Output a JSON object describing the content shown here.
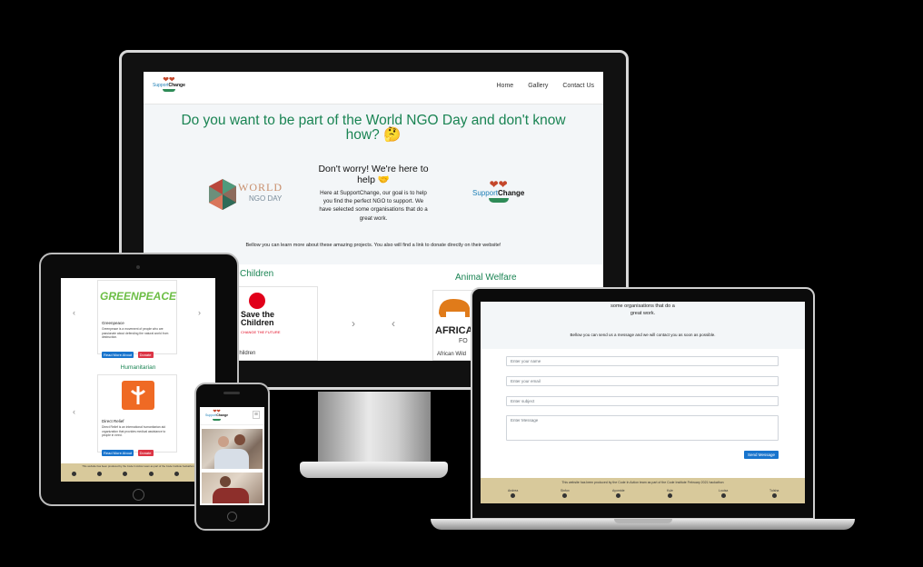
{
  "site": {
    "logo": {
      "light": "Support",
      "bold": "Change",
      "hearts": "❤❤"
    }
  },
  "desktop": {
    "nav": {
      "home": "Home",
      "gallery": "Gallery",
      "contact": "Contact Us"
    },
    "headline": "Do you want to be part of the World NGO Day and don't know how? 🤔",
    "world_ngo_logo": {
      "word": "WORLD",
      "ngo": "NGO DAY"
    },
    "worry_heading": "Don't worry! We're here to help 🤝",
    "intro": "Here at SupportChange, our goal is to help you find the perfect NGO to support. We have selected some organisations that do a great work.",
    "below_text": "Bellow you can learn more about these amazing projects. You also will find a link to donate directly on their website!",
    "categories": {
      "children": "Children",
      "animal": "Animal Welfare"
    },
    "cards": {
      "save_children_l1": "Save the",
      "save_children_l2": "Children",
      "save_children_tag": "CHANGE THE FUTURE",
      "children_caption": "Children",
      "african_logo": "AFRICA",
      "african_sub": "FO",
      "african_caption": "African Wild"
    },
    "arrows": {
      "next": "›",
      "prev": "‹"
    }
  },
  "tablet": {
    "greenpeace_logo": "GREENPEACE",
    "greenpeace_title": "Greenpeace",
    "greenpeace_desc": "Greenpeace is a movement of people who are passionate about defending the natural world from destruction.",
    "read_more": "Read More About",
    "donate": "Donate",
    "humanitarian": "Humanitarian",
    "direct_relief_title": "Direct Relief",
    "direct_relief_desc": "Direct Relief is an international humanitarian aid organization that provides medical assistance to people in need.",
    "footer_note": "This website has been produced by the Code In Action team as part of the Code Institute hackathon",
    "arrows": {
      "prev": "‹",
      "next": "›"
    }
  },
  "phone": {
    "menu": "≡"
  },
  "laptop": {
    "intro_tail_1": "some organisations that do a",
    "intro_tail_2": "great work.",
    "contact_intro": "Bellow you can send us a message and we will contact you as soon as possible.",
    "fields": {
      "name": "Enter your name",
      "email": "Enter your email",
      "subject": "Enter subject",
      "message": "Enter Message"
    },
    "send": "Send Message",
    "footer_note": "This website has been produced by the Code In Action team as part of the Code Institute February 2021 hackathon",
    "team": [
      "Andrea",
      "Sinfox",
      "Ayomide",
      "Kyle",
      "Louisa",
      "Tulsha"
    ]
  },
  "colors": {
    "accent_green": "#1a8453",
    "button_blue": "#1874cd",
    "donate_red": "#dc3545",
    "footer_tan": "#d8c99b"
  }
}
